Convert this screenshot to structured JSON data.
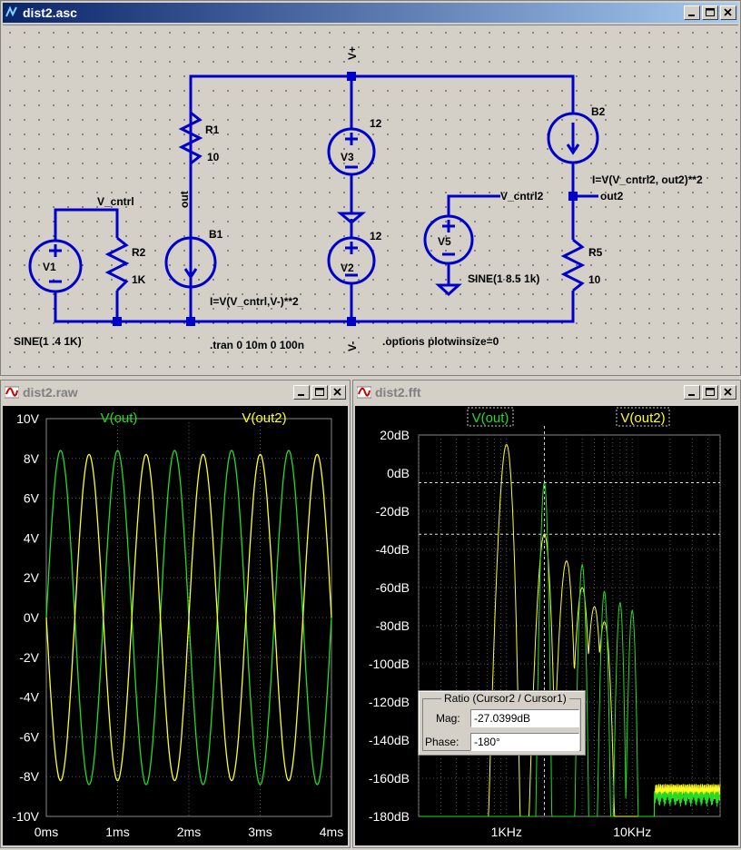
{
  "schematic": {
    "title": "dist2.asc",
    "labels": {
      "vplus": "V+",
      "vminus": "V-",
      "out": "out",
      "out2": "out2",
      "vctrl": "V_cntrl",
      "vctrl2": "V_cntrl2",
      "r1": "R1",
      "r1v": "10",
      "r2": "R2",
      "r2v": "1K",
      "r5": "R5",
      "r5v": "10",
      "v1": "V1",
      "v2": "V2",
      "v3": "V3",
      "v5": "V5",
      "v2val": "12",
      "v3val": "12",
      "b1": "B1",
      "b2": "B2",
      "b1expr": "I=V(V_cntrl,V-)**2",
      "b2expr": "I=V(V_cntrl2, out2)**2",
      "v1src": "SINE(1 .4 1K)",
      "v5src": "SINE(1 8.5 1k)",
      "tran": ".tran 0 10m 0 100n",
      "options": ".options plotwinsize=0"
    }
  },
  "raw": {
    "title": "dist2.raw",
    "trace1": "V(out)",
    "trace2": "V(out2)",
    "yticks": [
      "10V",
      "8V",
      "6V",
      "4V",
      "2V",
      "0V",
      "-2V",
      "-4V",
      "-6V",
      "-8V",
      "-10V"
    ],
    "xticks": [
      "0ms",
      "1ms",
      "2ms",
      "3ms",
      "4ms"
    ]
  },
  "fft": {
    "title": "dist2.fft",
    "trace1": "V(out)",
    "trace2": "V(out2)",
    "yticks": [
      "20dB",
      "0dB",
      "-20dB",
      "-40dB",
      "-60dB",
      "-80dB",
      "-100dB",
      "-120dB",
      "-140dB",
      "-160dB",
      "-180dB"
    ],
    "xticks": [
      "1KHz",
      "10KHz"
    ]
  },
  "cursor": {
    "title": "Ratio (Cursor2 / Cursor1)",
    "mag_label": "Mag:",
    "mag_value": "-27.0399dB",
    "phase_label": "Phase:",
    "phase_value": "-180°"
  },
  "colors": {
    "wire": "#0000cc",
    "trace1": "#22dd22",
    "trace2": "#ffff22",
    "grid": "#555555"
  },
  "chart_data": [
    {
      "type": "line",
      "x": [
        0,
        1,
        2,
        3,
        4
      ],
      "series": [
        {
          "name": "V(out)",
          "values": [
            0,
            0,
            0,
            0,
            0
          ]
        },
        {
          "name": "V(out2)",
          "values": [
            0,
            0,
            0,
            0,
            0
          ]
        }
      ],
      "xlim": [
        0,
        4
      ],
      "ylim": [
        -10,
        10
      ],
      "v_out_amplitude": 8.4,
      "v_out_period_ms": 0.8,
      "v_out2_amplitude": 8.2,
      "v_out2_period_ms": 0.8,
      "grid": true
    },
    {
      "type": "line",
      "series": [
        {
          "name": "V(out)",
          "peaks_hz": [
            2000,
            4000,
            6000,
            8000,
            10000
          ],
          "peaks_db": [
            -5,
            -48,
            -62,
            -68,
            -72
          ]
        },
        {
          "name": "V(out2)",
          "peaks_hz": [
            1000,
            2000,
            3000,
            4000,
            5000,
            6000
          ],
          "peaks_db": [
            15,
            -32,
            -46,
            -60,
            -70,
            -78
          ]
        }
      ],
      "ylim": [
        -180,
        20
      ],
      "xscale": "log",
      "grid": true
    }
  ]
}
